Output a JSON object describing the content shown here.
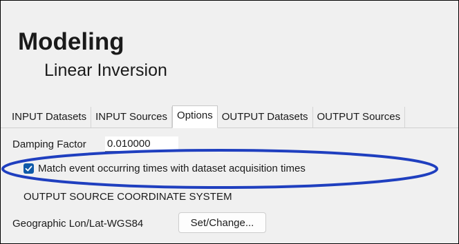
{
  "header": {
    "title": "Modeling",
    "subtitle": "Linear Inversion"
  },
  "tabs": [
    {
      "label": "INPUT Datasets",
      "active": false
    },
    {
      "label": "INPUT Sources",
      "active": false
    },
    {
      "label": "Options",
      "active": true
    },
    {
      "label": "OUTPUT Datasets",
      "active": false
    },
    {
      "label": "OUTPUT Sources",
      "active": false
    }
  ],
  "options": {
    "damping_label": "Damping Factor",
    "damping_value": "0.010000",
    "match_times_label": "Match event occurring times with dataset acquisition times",
    "match_times_checked": true,
    "coord_section_heading": "OUTPUT SOURCE COORDINATE SYSTEM",
    "coord_system_value": "Geographic Lon/Lat-WGS84",
    "set_change_label": "Set/Change..."
  },
  "colors": {
    "annotation_ellipse": "#1f3fbf",
    "checkbox_fill": "#0f5aa8"
  }
}
